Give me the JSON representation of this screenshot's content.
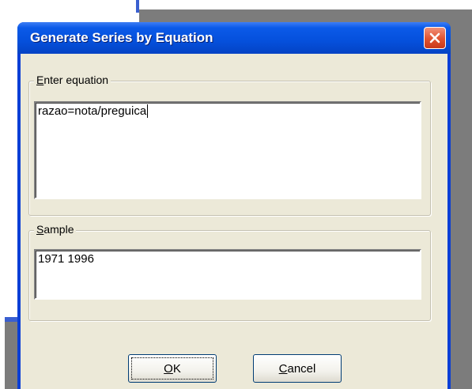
{
  "dialog": {
    "title": "Generate Series by Equation"
  },
  "equation_group": {
    "legend_mnemonic": "E",
    "legend_rest": "nter equation",
    "value": "razao=nota/preguica"
  },
  "sample_group": {
    "legend_mnemonic": "S",
    "legend_rest": "ample",
    "value": "1971 1996"
  },
  "buttons": {
    "ok_mnemonic": "O",
    "ok_rest": "K",
    "cancel_mnemonic": "C",
    "cancel_rest": "ancel"
  },
  "icons": {
    "close": "close-icon"
  },
  "colors": {
    "titlebar": "#0550dc",
    "close_button": "#e0522f",
    "dialog_background": "#ece9d8",
    "button_border": "#003c74"
  }
}
